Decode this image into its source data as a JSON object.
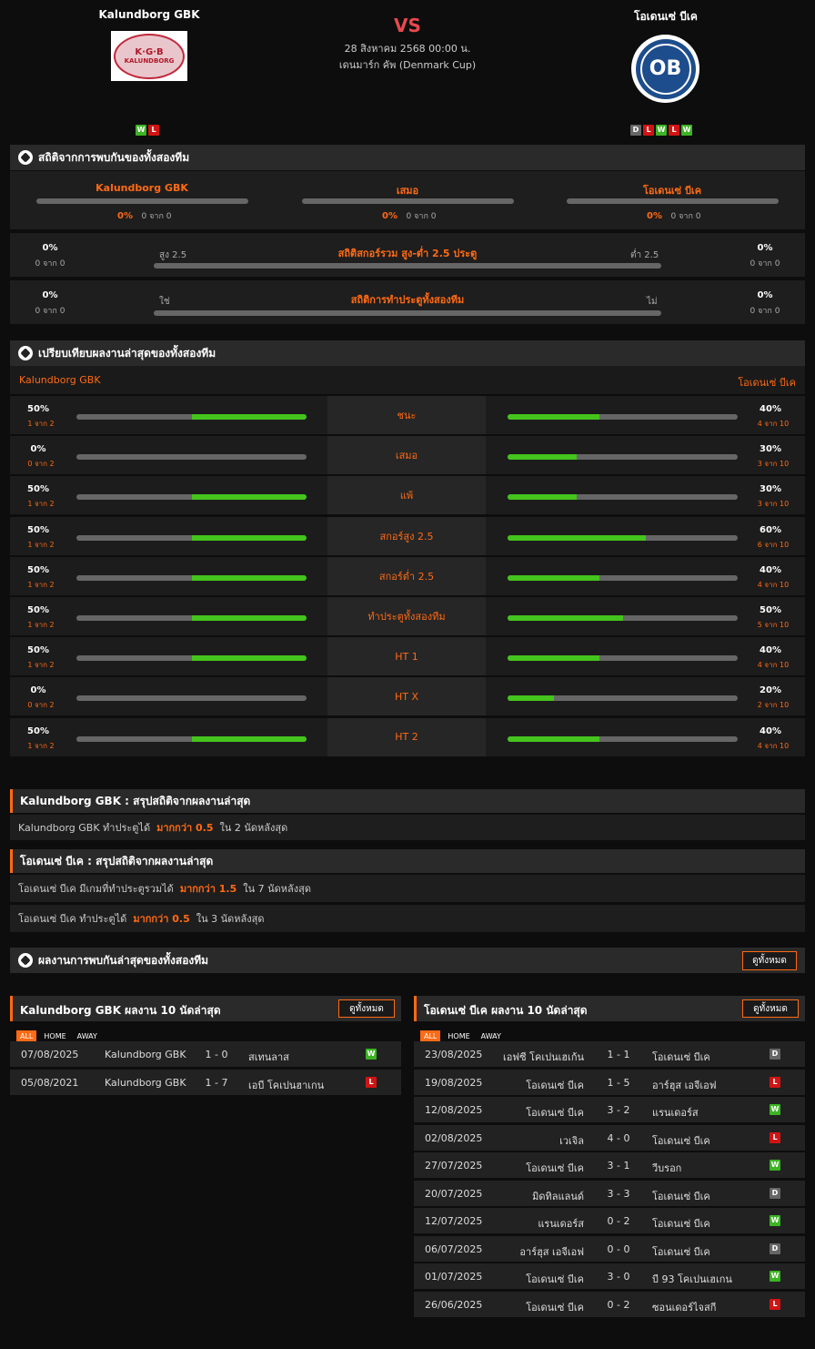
{
  "header": {
    "home_name": "Kalundborg GBK",
    "away_name": "โอเดนเซ่ บีเค",
    "vs": "VS",
    "datetime": "28 สิงหาคม 2568 00:00 น.",
    "competition": "เดนมาร์ก คัพ (Denmark Cup)",
    "home_logo_text_top": "K·G·B",
    "home_logo_text_bottom": "KALUNDBORG",
    "away_logo_text": "OB",
    "home_form": [
      "W",
      "L"
    ],
    "away_form": [
      "D",
      "L",
      "W",
      "L",
      "W"
    ]
  },
  "h2h": {
    "title": "สถิติจากการพบกันของทั้งสองทีม",
    "cols": [
      {
        "label": "Kalundborg GBK",
        "pct": "0%",
        "sub": "0 จาก 0"
      },
      {
        "label": "เสมอ",
        "pct": "0%",
        "sub": "0 จาก 0"
      },
      {
        "label": "โอเดนเซ่ บีเค",
        "pct": "0%",
        "sub": "0 จาก 0"
      }
    ],
    "ou": {
      "title": "สถิติสกอร์รวม สูง-ต่ำ 2.5 ประตู",
      "left_label": "สูง 2.5",
      "right_label": "ต่ำ 2.5",
      "lpct": "0%",
      "lsub": "0 จาก 0",
      "rpct": "0%",
      "rsub": "0 จาก 0"
    },
    "btts": {
      "title": "สถิติการทำประตูทั้งสองทีม",
      "left_label": "ใช่",
      "right_label": "ไม่",
      "lpct": "0%",
      "lsub": "0 จาก 0",
      "rpct": "0%",
      "rsub": "0 จาก 0"
    }
  },
  "compare": {
    "title": "เปรียบเทียบผลงานล่าสุดของทั้งสองทีม",
    "home": "Kalundborg GBK",
    "away": "โอเดนเซ่ บีเค",
    "rows": [
      {
        "label": "ชนะ",
        "lpct": "50%",
        "lsub": "1 จาก 2",
        "lval": 50,
        "rpct": "40%",
        "rsub": "4 จาก 10",
        "rval": 40
      },
      {
        "label": "เสมอ",
        "lpct": "0%",
        "lsub": "0 จาก 2",
        "lval": 0,
        "rpct": "30%",
        "rsub": "3 จาก 10",
        "rval": 30
      },
      {
        "label": "แพ้",
        "lpct": "50%",
        "lsub": "1 จาก 2",
        "lval": 50,
        "rpct": "30%",
        "rsub": "3 จาก 10",
        "rval": 30
      },
      {
        "label": "สกอร์สูง 2.5",
        "lpct": "50%",
        "lsub": "1 จาก 2",
        "lval": 50,
        "rpct": "60%",
        "rsub": "6 จาก 10",
        "rval": 60
      },
      {
        "label": "สกอร์ต่ำ 2.5",
        "lpct": "50%",
        "lsub": "1 จาก 2",
        "lval": 50,
        "rpct": "40%",
        "rsub": "4 จาก 10",
        "rval": 40
      },
      {
        "label": "ทำประตูทั้งสองทีม",
        "lpct": "50%",
        "lsub": "1 จาก 2",
        "lval": 50,
        "rpct": "50%",
        "rsub": "5 จาก 10",
        "rval": 50
      },
      {
        "label": "HT 1",
        "lpct": "50%",
        "lsub": "1 จาก 2",
        "lval": 50,
        "rpct": "40%",
        "rsub": "4 จาก 10",
        "rval": 40
      },
      {
        "label": "HT X",
        "lpct": "0%",
        "lsub": "0 จาก 2",
        "lval": 0,
        "rpct": "20%",
        "rsub": "2 จาก 10",
        "rval": 20
      },
      {
        "label": "HT 2",
        "lpct": "50%",
        "lsub": "1 จาก 2",
        "lval": 50,
        "rpct": "40%",
        "rsub": "4 จาก 10",
        "rval": 40
      }
    ]
  },
  "summary_home": {
    "title": "Kalundborg GBK : สรุปสถิติจากผลงานล่าสุด",
    "lines": [
      {
        "pre": "Kalundborg GBK  ทำประตูได้",
        "hl": "มากกว่า  0.5",
        "post": "ใน 2 นัดหลังสุด"
      }
    ]
  },
  "summary_away": {
    "title": "โอเดนเซ่ บีเค : สรุปสถิติจากผลงานล่าสุด",
    "lines": [
      {
        "pre": "โอเดนเซ่ บีเค  มีเกมที่ทำประตูรวมได้",
        "hl": "มากกว่า  1.5",
        "post": "ใน 7 นัดหลังสุด"
      },
      {
        "pre": "โอเดนเซ่ บีเค  ทำประตูได้",
        "hl": "มากกว่า  0.5",
        "post": "ใน 3 นัดหลังสุด"
      }
    ]
  },
  "h2h_results": {
    "title": "ผลงานการพบกันล่าสุดของทั้งสองทีม",
    "view_all": "ดูทั้งหมด"
  },
  "tabs": [
    "ALL",
    "HOME",
    "AWAY"
  ],
  "home_last": {
    "title": "Kalundborg GBK ผลงาน 10 นัดล่าสุด",
    "view_all": "ดูทั้งหมด",
    "matches": [
      {
        "date": "07/08/2025",
        "home": "Kalundborg GBK",
        "score": "1 - 0",
        "away": "สเทนลาส",
        "res": "W"
      },
      {
        "date": "05/08/2021",
        "home": "Kalundborg GBK",
        "score": "1 - 7",
        "away": "เอบี โคเปนฮาเกน",
        "res": "L"
      }
    ]
  },
  "away_last": {
    "title": "โอเดนเซ่ บีเค ผลงาน 10 นัดล่าสุด",
    "view_all": "ดูทั้งหมด",
    "matches": [
      {
        "date": "23/08/2025",
        "home": "เอฟซี โคเปนเฮเก้น",
        "score": "1 - 1",
        "away": "โอเดนเซ่ บีเค",
        "res": "D"
      },
      {
        "date": "19/08/2025",
        "home": "โอเดนเซ่ บีเค",
        "score": "1 - 5",
        "away": "อาร์ฮุส เอจีเอฟ",
        "res": "L"
      },
      {
        "date": "12/08/2025",
        "home": "โอเดนเซ่ บีเค",
        "score": "3 - 2",
        "away": "แรนเดอร์ส",
        "res": "W"
      },
      {
        "date": "02/08/2025",
        "home": "เวเจิล",
        "score": "4 - 0",
        "away": "โอเดนเซ่ บีเค",
        "res": "L"
      },
      {
        "date": "27/07/2025",
        "home": "โอเดนเซ่ บีเค",
        "score": "3 - 1",
        "away": "วีบรอก",
        "res": "W"
      },
      {
        "date": "20/07/2025",
        "home": "มิดทิลแลนด์",
        "score": "3 - 3",
        "away": "โอเดนเซ่ บีเค",
        "res": "D"
      },
      {
        "date": "12/07/2025",
        "home": "แรนเดอร์ส",
        "score": "0 - 2",
        "away": "โอเดนเซ่ บีเค",
        "res": "W"
      },
      {
        "date": "06/07/2025",
        "home": "อาร์ฮุส เอจีเอฟ",
        "score": "0 - 0",
        "away": "โอเดนเซ่ บีเค",
        "res": "D"
      },
      {
        "date": "01/07/2025",
        "home": "โอเดนเซ่ บีเค",
        "score": "3 - 0",
        "away": "บี 93 โคเปนเฮเกน",
        "res": "W"
      },
      {
        "date": "26/06/2025",
        "home": "โอเดนเซ่ บีเค",
        "score": "0 - 2",
        "away": "ซอนเดอร์ไจสกี",
        "res": "L"
      }
    ]
  },
  "colors": {
    "accent": "#ff6a14",
    "win": "#3cb424",
    "loss": "#d01414",
    "draw": "#666666",
    "bar_fill": "#44c41c"
  }
}
